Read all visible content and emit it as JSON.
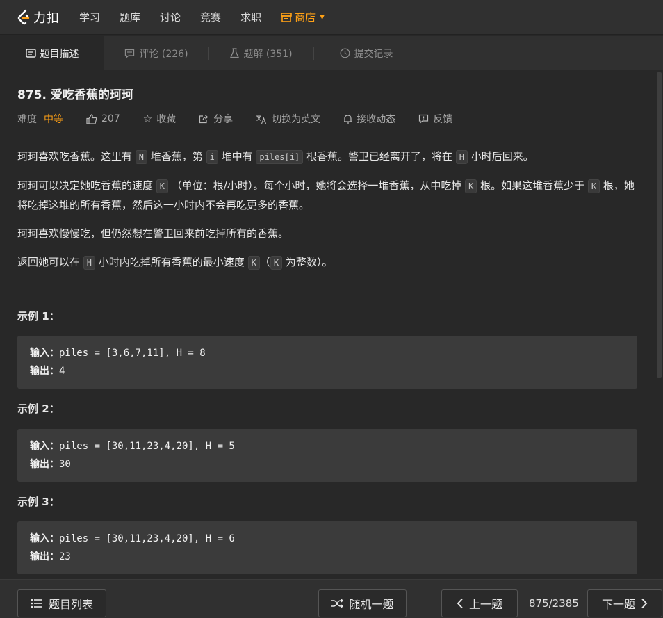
{
  "nav": {
    "logo_text": "力扣",
    "items": [
      "学习",
      "题库",
      "讨论",
      "竞赛",
      "求职"
    ],
    "shop": "商店"
  },
  "tabs": [
    {
      "label": "题目描述",
      "active": true
    },
    {
      "label": "评论 (226)",
      "active": false
    },
    {
      "label": "题解 (351)",
      "active": false
    },
    {
      "label": "提交记录",
      "active": false
    }
  ],
  "problem": {
    "title": "875. 爱吃香蕉的珂珂",
    "difficulty_label": "难度",
    "difficulty": "中等",
    "likes": "207",
    "favorite": "收藏",
    "share": "分享",
    "switch_lang": "切换为英文",
    "subscribe": "接收动态",
    "feedback": "反馈"
  },
  "desc": {
    "p1": {
      "a": "珂珂喜欢吃香蕉。这里有 ",
      "c1": "N",
      "b": " 堆香蕉，第 ",
      "c2": "i",
      "d": " 堆中有 ",
      "c3": "piles[i]",
      "e": " 根香蕉。警卫已经离开了，将在 ",
      "c4": "H",
      "f": " 小时后回来。"
    },
    "p2": {
      "a": "珂珂可以决定她吃香蕉的速度 ",
      "c1": "K",
      "b": " （单位：根/小时）。每个小时，她将会选择一堆香蕉，从中吃掉 ",
      "c2": "K",
      "d": " 根。如果这堆香蕉少于 ",
      "c3": "K",
      "e": " 根，她将吃掉这堆的所有香蕉，然后这一小时内不会再吃更多的香蕉。"
    },
    "p3": "珂珂喜欢慢慢吃，但仍然想在警卫回来前吃掉所有的香蕉。",
    "p4": {
      "a": "返回她可以在 ",
      "c1": "H",
      "b": " 小时内吃掉所有香蕉的最小速度 ",
      "c2": "K",
      "d": "（",
      "c3": "K",
      "e": " 为整数）。"
    }
  },
  "examples": [
    {
      "title": "示例 1：",
      "input_label": "输入：",
      "input": "piles = [3,6,7,11], H = 8",
      "output_label": "输出：",
      "output": "4"
    },
    {
      "title": "示例 2：",
      "input_label": "输入：",
      "input": "piles = [30,11,23,4,20], H = 5",
      "output_label": "输出：",
      "output": "30"
    },
    {
      "title": "示例 3：",
      "input_label": "输入：",
      "input": "piles = [30,11,23,4,20], H = 6",
      "output_label": "输出：",
      "output": "23"
    }
  ],
  "bottom": {
    "list": "题目列表",
    "random": "随机一题",
    "prev": "上一题",
    "page": "875/2385",
    "next": "下一题"
  }
}
